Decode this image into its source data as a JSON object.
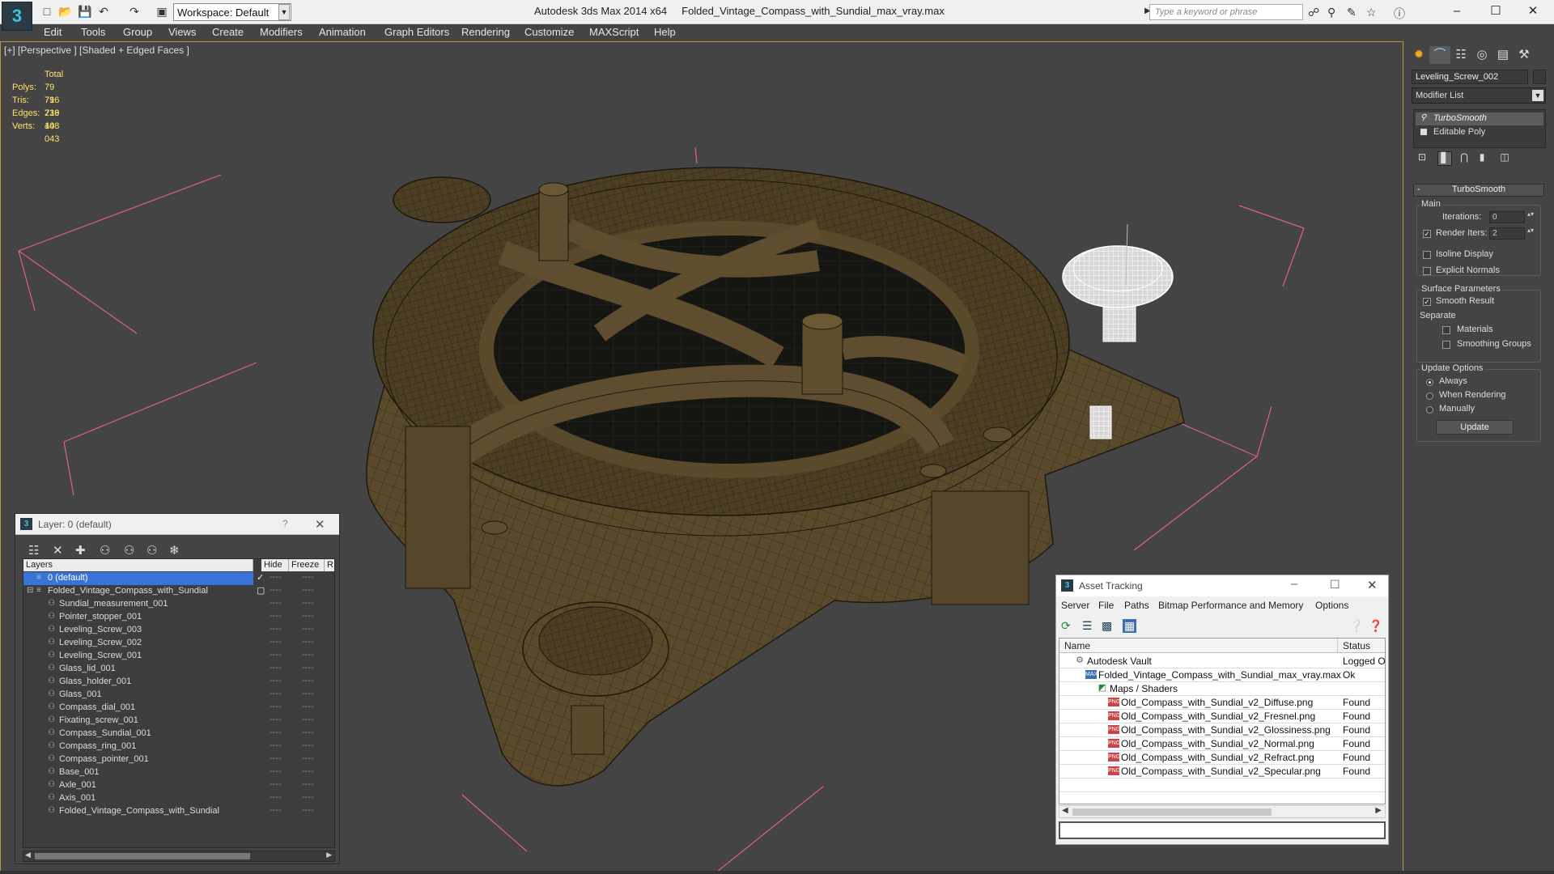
{
  "titlebar": {
    "workspace": "Workspace: Default",
    "app": "Autodesk 3ds Max  2014 x64",
    "file": "Folded_Vintage_Compass_with_Sundial_max_vray.max",
    "search_placeholder": "Type a keyword or phrase"
  },
  "menu": [
    "Edit",
    "Tools",
    "Group",
    "Views",
    "Create",
    "Modifiers",
    "Animation",
    "Graph Editors",
    "Rendering",
    "Customize",
    "MAXScript",
    "Help"
  ],
  "viewport": {
    "label": "[+] [Perspective ] [Shaded + Edged Faces ]",
    "stats": {
      "total_label": "Total",
      "rows": [
        {
          "k": "Polys:",
          "v": "79 716"
        },
        {
          "k": "Tris:",
          "v": "79 716"
        },
        {
          "k": "Edges:",
          "v": "239 148"
        },
        {
          "k": "Verts:",
          "v": "40 043"
        }
      ]
    }
  },
  "command_panel": {
    "object_name": "Leveling_Screw_002",
    "modifier_list": "Modifier List",
    "stack": [
      "TurboSmooth",
      "Editable Poly"
    ],
    "rollout_title": "TurboSmooth",
    "main_label": "Main",
    "iterations_label": "Iterations:",
    "iterations_value": "0",
    "render_iters_label": "Render Iters:",
    "render_iters_value": "2",
    "isoline_label": "Isoline Display",
    "explicit_normals_label": "Explicit Normals",
    "surface_params_label": "Surface Parameters",
    "smooth_result_label": "Smooth Result",
    "separate_label": "Separate",
    "materials_label": "Materials",
    "smoothing_groups_label": "Smoothing Groups",
    "update_options_label": "Update Options",
    "always_label": "Always",
    "when_rendering_label": "When Rendering",
    "manually_label": "Manually",
    "update_button": "Update"
  },
  "layer_window": {
    "title": "Layer: 0 (default)",
    "help": "?",
    "columns": {
      "layers": "Layers",
      "hide": "Hide",
      "freeze": "Freeze",
      "extra": "R"
    },
    "layers": [
      {
        "name": "0 (default)",
        "level": 0,
        "selected": true
      },
      {
        "name": "Folded_Vintage_Compass_with_Sundial",
        "level": 0,
        "selected": false
      },
      {
        "name": "Sundial_measurement_001",
        "level": 1
      },
      {
        "name": "Pointer_stopper_001",
        "level": 1
      },
      {
        "name": "Leveling_Screw_003",
        "level": 1
      },
      {
        "name": "Leveling_Screw_002",
        "level": 1
      },
      {
        "name": "Leveling_Screw_001",
        "level": 1
      },
      {
        "name": "Glass_lid_001",
        "level": 1
      },
      {
        "name": "Glass_holder_001",
        "level": 1
      },
      {
        "name": "Glass_001",
        "level": 1
      },
      {
        "name": "Compass_dial_001",
        "level": 1
      },
      {
        "name": "Fixating_screw_001",
        "level": 1
      },
      {
        "name": "Compass_Sundial_001",
        "level": 1
      },
      {
        "name": "Compass_ring_001",
        "level": 1
      },
      {
        "name": "Compass_pointer_001",
        "level": 1
      },
      {
        "name": "Base_001",
        "level": 1
      },
      {
        "name": "Axle_001",
        "level": 1
      },
      {
        "name": "Axis_001",
        "level": 1
      },
      {
        "name": "Folded_Vintage_Compass_with_Sundial",
        "level": 1
      }
    ],
    "hide_placeholder": "----",
    "freeze_placeholder": "----"
  },
  "asset_window": {
    "title": "Asset Tracking",
    "menu": [
      "Server",
      "File",
      "Paths",
      "Bitmap Performance and Memory",
      "Options"
    ],
    "columns": {
      "name": "Name",
      "status": "Status"
    },
    "rows": [
      {
        "name": "Autodesk Vault",
        "status": "Logged Ou",
        "indent": 0,
        "icon": "vault"
      },
      {
        "name": "Folded_Vintage_Compass_with_Sundial_max_vray.max",
        "status": "Ok",
        "indent": 1,
        "icon": "max"
      },
      {
        "name": "Maps / Shaders",
        "status": "",
        "indent": 2,
        "icon": "maps"
      },
      {
        "name": "Old_Compass_with_Sundial_v2_Diffuse.png",
        "status": "Found",
        "indent": 3,
        "icon": "png"
      },
      {
        "name": "Old_Compass_with_Sundial_v2_Fresnel.png",
        "status": "Found",
        "indent": 3,
        "icon": "png"
      },
      {
        "name": "Old_Compass_with_Sundial_v2_Glossiness.png",
        "status": "Found",
        "indent": 3,
        "icon": "png"
      },
      {
        "name": "Old_Compass_with_Sundial_v2_Normal.png",
        "status": "Found",
        "indent": 3,
        "icon": "png"
      },
      {
        "name": "Old_Compass_with_Sundial_v2_Refract.png",
        "status": "Found",
        "indent": 3,
        "icon": "png"
      },
      {
        "name": "Old_Compass_with_Sundial_v2_Specular.png",
        "status": "Found",
        "indent": 3,
        "icon": "png"
      }
    ],
    "png_tag": "PNG",
    "max_tag": "MAX"
  },
  "colors": {
    "model": "#5a4a2c",
    "model_dark": "#2f2716",
    "wire": "#1f1a10",
    "gizmo": "#e0608a",
    "selection": "#3874d8"
  }
}
